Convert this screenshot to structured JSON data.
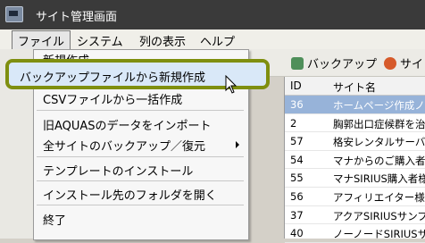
{
  "window": {
    "title": "サイト管理画面"
  },
  "menubar": {
    "file": "ファイル",
    "system": "システム",
    "view": "列の表示",
    "help": "ヘルプ"
  },
  "toolbar": {
    "backup": "バックアップ",
    "site": "サイ"
  },
  "file_menu": {
    "items": [
      "新規作成",
      "バックアップファイルから新規作成",
      "CSVファイルから一括作成",
      "旧AQUASのデータをインポート",
      "全サイトのバックアップ／復元",
      "テンプレートのインストール",
      "インストール先のフォルダを開く",
      "終了"
    ]
  },
  "list": {
    "headers": {
      "id": "ID",
      "name": "サイト名"
    },
    "rows": [
      {
        "id": "36",
        "name": "ホームページ作成ノ"
      },
      {
        "id": "2",
        "name": "胸郭出口症候群を治"
      },
      {
        "id": "57",
        "name": "格安レンタルサーバー"
      },
      {
        "id": "54",
        "name": "マナからのご購入者"
      },
      {
        "id": "55",
        "name": "マナSIRIUS購入者様"
      },
      {
        "id": "56",
        "name": "アフィリエイター様向"
      },
      {
        "id": "37",
        "name": "アクアSIRIUSサンプル"
      },
      {
        "id": "40",
        "name": "ノーノードSIRIUSサ"
      }
    ]
  },
  "icons": {
    "app": "app-icon",
    "backup": "backup-icon",
    "site": "site-icon",
    "cursor": "cursor-icon",
    "submenu": "chevron-right-icon"
  }
}
